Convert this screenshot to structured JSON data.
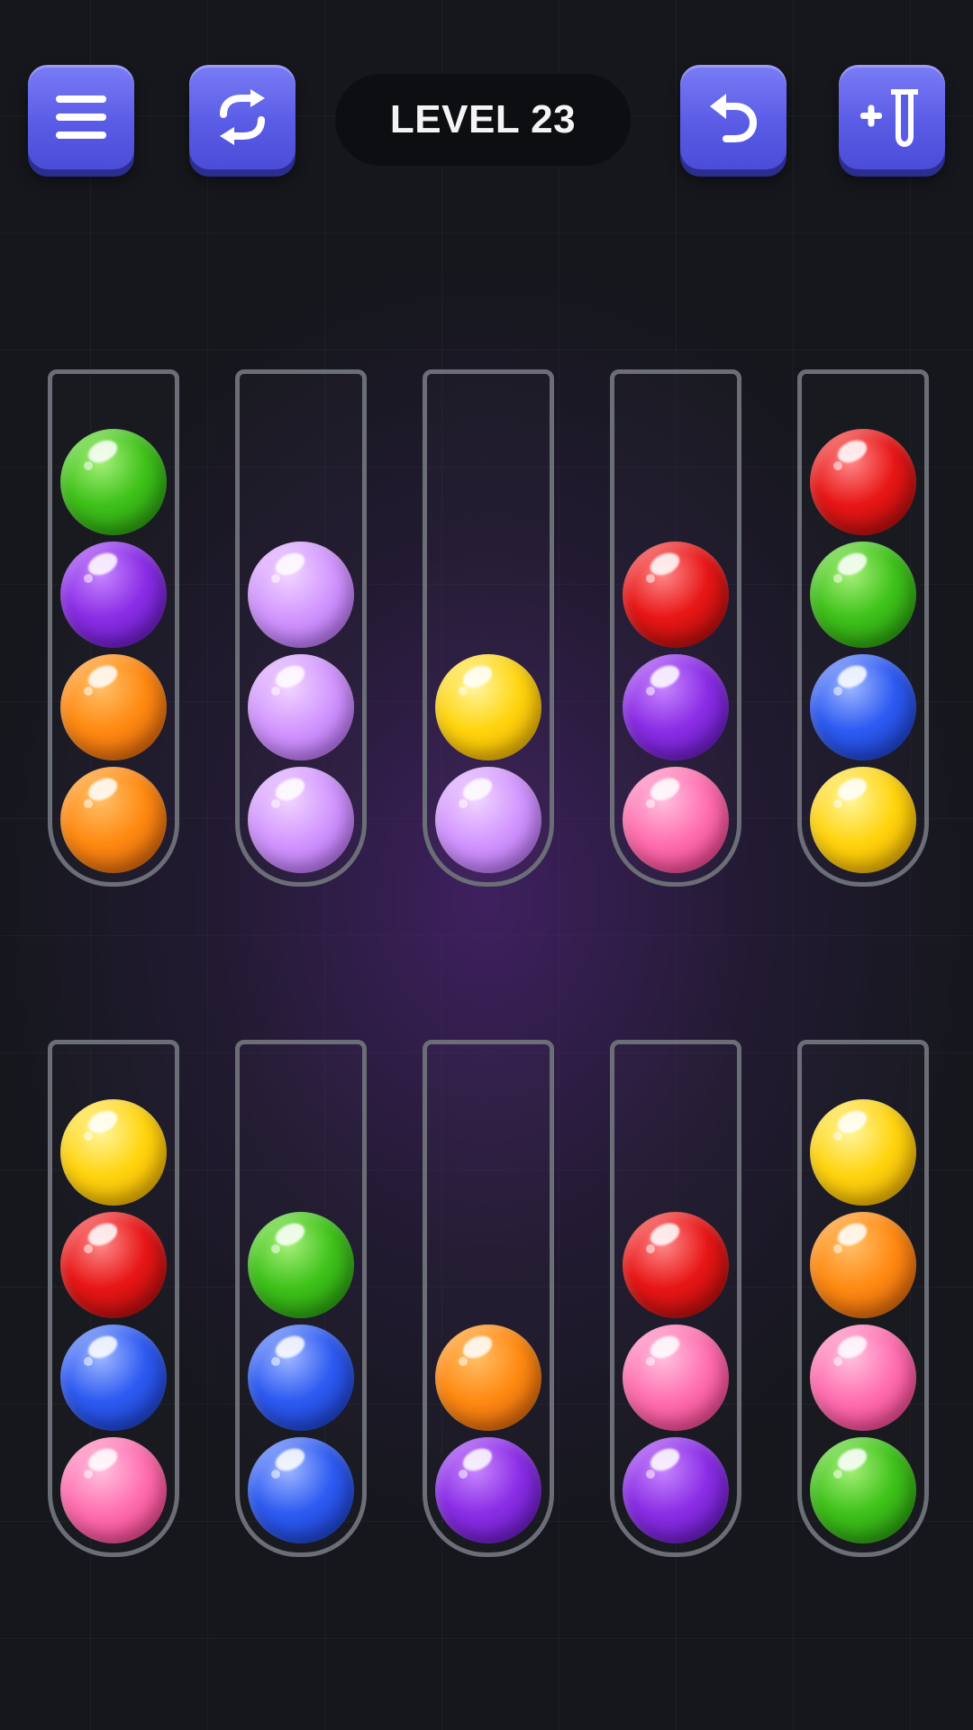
{
  "header": {
    "level_text": "LEVEL 23",
    "buttons": {
      "menu": "menu-icon",
      "restart": "restart-icon",
      "undo": "undo-icon",
      "add_tube": "add-tube-icon"
    }
  },
  "colors": {
    "green": [
      "#a6f07a",
      "#3fc21a",
      "#1f8a0c"
    ],
    "purple": [
      "#c887ff",
      "#8b2ee6",
      "#5812b0"
    ],
    "orange": [
      "#ffc06a",
      "#ff8a12",
      "#c8550a"
    ],
    "lilac": [
      "#f2d6ff",
      "#d397ff",
      "#a862e6"
    ],
    "yellow": [
      "#fff6a0",
      "#ffd40e",
      "#e0a000"
    ],
    "red": [
      "#ff8a8a",
      "#e81616",
      "#9c0a0a"
    ],
    "blue": [
      "#a0b8ff",
      "#2e5bf2",
      "#1434b8"
    ],
    "pink": [
      "#ffc2e0",
      "#ff70b0",
      "#e0307c"
    ]
  },
  "board": {
    "capacity": 4,
    "rows": [
      [
        [
          "green",
          "purple",
          "orange",
          "orange"
        ],
        [
          "lilac",
          "lilac",
          "lilac"
        ],
        [
          "yellow",
          "lilac"
        ],
        [
          "red",
          "purple",
          "pink"
        ],
        [
          "red",
          "green",
          "blue",
          "yellow"
        ]
      ],
      [
        [
          "yellow",
          "red",
          "blue",
          "pink"
        ],
        [
          "green",
          "blue",
          "blue"
        ],
        [
          "orange",
          "purple"
        ],
        [
          "red",
          "pink",
          "purple"
        ],
        [
          "yellow",
          "orange",
          "pink",
          "green"
        ]
      ]
    ]
  }
}
